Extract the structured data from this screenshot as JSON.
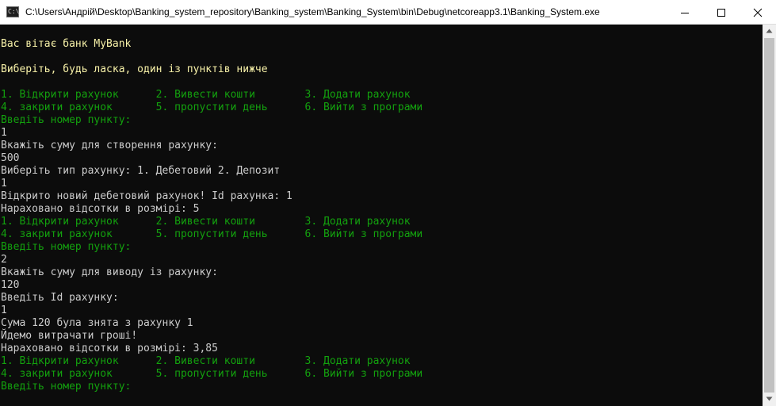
{
  "window": {
    "title": "C:\\Users\\Андрій\\Desktop\\Banking_system_repository\\Banking_system\\Banking_System\\bin\\Debug\\netcoreapp3.1\\Banking_System.exe",
    "icon_label": "C:\\",
    "icon": "console-app-icon",
    "controls": [
      "minimize-icon",
      "maximize-icon",
      "close-icon"
    ]
  },
  "colors": {
    "background": "#0c0c0c",
    "yellow": "#f7f1a8",
    "green": "#13a10e",
    "white": "#cccccc"
  },
  "console": {
    "lines": [
      "",
      "Вас вітає банк MyBank",
      "",
      "Виберіть, будь ласка, один із пунктів нижче",
      "",
      "1. Відкрити рахунок      2. Вивести кошти        3. Додати рахунок",
      "4. закрити рахунок       5. пропустити день      6. Вийти з програми",
      "Введіть номер пункту:",
      "1",
      "Вкажіть суму для створення рахунку:",
      "500",
      "Виберіть тип рахунку: 1. Дебетовий 2. Депозит",
      "1",
      "Відкрито новий дебетовий рахунок! Id рахунка: 1",
      "Нараховано відсотки в розмірі: 5",
      "1. Відкрити рахунок      2. Вивести кошти        3. Додати рахунок",
      "4. закрити рахунок       5. пропустити день      6. Вийти з програми",
      "Введіть номер пункту:",
      "2",
      "Вкажіть суму для виводу із рахунку:",
      "120",
      "Введіть Id рахунку:",
      "1",
      "Сума 120 була знята з рахунку 1",
      "Йдемо витрачати гроші!",
      "Нараховано відсотки в розмірі: 3,85",
      "1. Відкрити рахунок      2. Вивести кошти        3. Додати рахунок",
      "4. закрити рахунок       5. пропустити день      6. Вийти з програми",
      "Введіть номер пункту:"
    ]
  },
  "scrollbar": {
    "up_icon": "scroll-up-arrow-icon",
    "down_icon": "scroll-down-arrow-icon"
  }
}
